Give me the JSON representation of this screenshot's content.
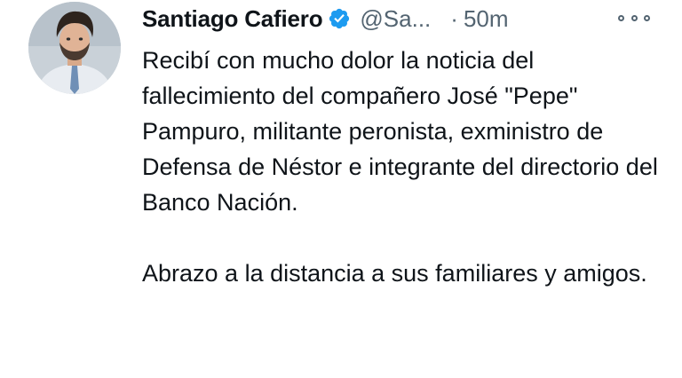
{
  "tweet": {
    "author_name": "Santiago Cafiero",
    "handle": "@Sa...",
    "separator": "·",
    "time": "50m",
    "paragraphs": [
      "Recibí con mucho dolor la noticia del fallecimiento del compañero José \"Pepe\" Pampuro, militante peronista, exministro de Defensa de Néstor e integrante del directorio del Banco Nación.",
      "Abrazo a la distancia a sus familiares y amigos."
    ],
    "icons": {
      "verified": "verified-badge-icon",
      "more": "more-options-icon"
    },
    "colors": {
      "verified": "#1d9bf0",
      "secondary_text": "#536471",
      "primary_text": "#0f1419"
    }
  }
}
